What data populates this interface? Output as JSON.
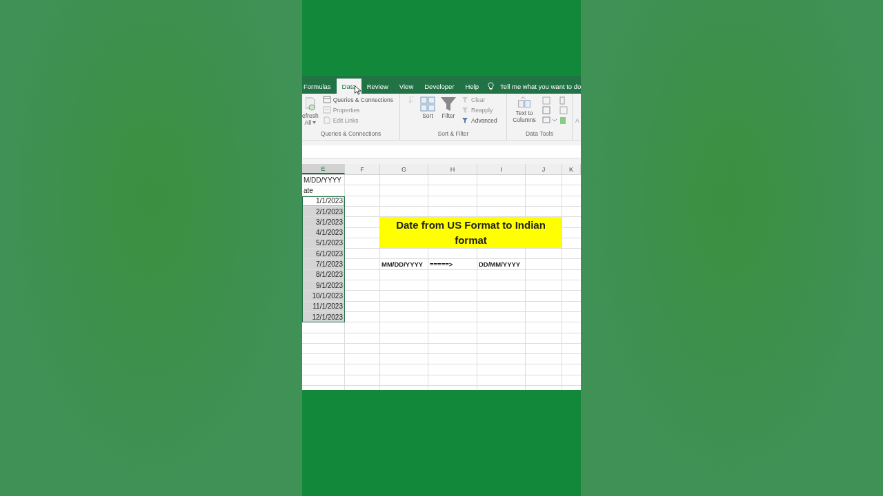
{
  "ribbon": {
    "tabs": [
      {
        "label": "Formulas",
        "selected": false
      },
      {
        "label": "Data",
        "selected": true
      },
      {
        "label": "Review",
        "selected": false
      },
      {
        "label": "View",
        "selected": false
      },
      {
        "label": "Developer",
        "selected": false
      },
      {
        "label": "Help",
        "selected": false
      }
    ],
    "tell_me": "Tell me what you want to do",
    "queries_group": {
      "refresh_label": "efresh",
      "refresh_sub": "All",
      "items": [
        {
          "label": "Queries & Connections",
          "disabled": false
        },
        {
          "label": "Properties",
          "disabled": true
        },
        {
          "label": "Edit Links",
          "disabled": true
        }
      ],
      "label": "Queries & Connections"
    },
    "sort_group": {
      "sort": "Sort",
      "filter": "Filter",
      "items": [
        {
          "label": "Clear",
          "disabled": true
        },
        {
          "label": "Reapply",
          "disabled": true
        },
        {
          "label": "Advanced",
          "disabled": false
        }
      ],
      "label": "Sort & Filter"
    },
    "tools_group": {
      "text_to_columns": "Text to Columns",
      "label": "Data Tools"
    },
    "next_group_fragment": "A"
  },
  "sheet": {
    "columns": [
      {
        "label": "E",
        "selected": true
      },
      {
        "label": "F",
        "selected": false
      },
      {
        "label": "G",
        "selected": false
      },
      {
        "label": "H",
        "selected": false
      },
      {
        "label": "I",
        "selected": false
      },
      {
        "label": "J",
        "selected": false
      },
      {
        "label": "K",
        "selected": false
      }
    ],
    "rows": [
      {
        "e": {
          "text": "M/DD/YYYY",
          "kind": "text",
          "selected": false
        }
      },
      {
        "e": {
          "text": "ate",
          "kind": "text",
          "selected": false
        }
      },
      {
        "e": {
          "text": "1/1/2023",
          "kind": "date",
          "selected": true,
          "active": true
        }
      },
      {
        "e": {
          "text": "2/1/2023",
          "kind": "date",
          "selected": true,
          "active": false
        }
      },
      {
        "e": {
          "text": "3/1/2023",
          "kind": "date",
          "selected": true,
          "active": false
        }
      },
      {
        "e": {
          "text": "4/1/2023",
          "kind": "date",
          "selected": true,
          "active": false
        }
      },
      {
        "e": {
          "text": "5/1/2023",
          "kind": "date",
          "selected": true,
          "active": false
        }
      },
      {
        "e": {
          "text": "6/1/2023",
          "kind": "date",
          "selected": true,
          "active": false
        }
      },
      {
        "e": {
          "text": "7/1/2023",
          "kind": "date",
          "selected": true,
          "active": false
        },
        "g": {
          "text": "MM/DD/YYYY",
          "kind": "bold",
          "selected": false
        },
        "h": {
          "text": "=====>",
          "kind": "bold",
          "selected": false
        },
        "i": {
          "text": "DD/MM/YYYY",
          "kind": "bold",
          "selected": false
        }
      },
      {
        "e": {
          "text": "8/1/2023",
          "kind": "date",
          "selected": true,
          "active": false
        }
      },
      {
        "e": {
          "text": "9/1/2023",
          "kind": "date",
          "selected": true,
          "active": false
        }
      },
      {
        "e": {
          "text": "10/1/2023",
          "kind": "date",
          "selected": true,
          "active": false
        }
      },
      {
        "e": {
          "text": "11/1/2023",
          "kind": "date",
          "selected": true,
          "active": false
        }
      },
      {
        "e": {
          "text": "12/1/2023",
          "kind": "date",
          "selected": true,
          "active": false
        }
      }
    ],
    "title_cell": {
      "text": "Date from US Format to Indian format"
    }
  }
}
